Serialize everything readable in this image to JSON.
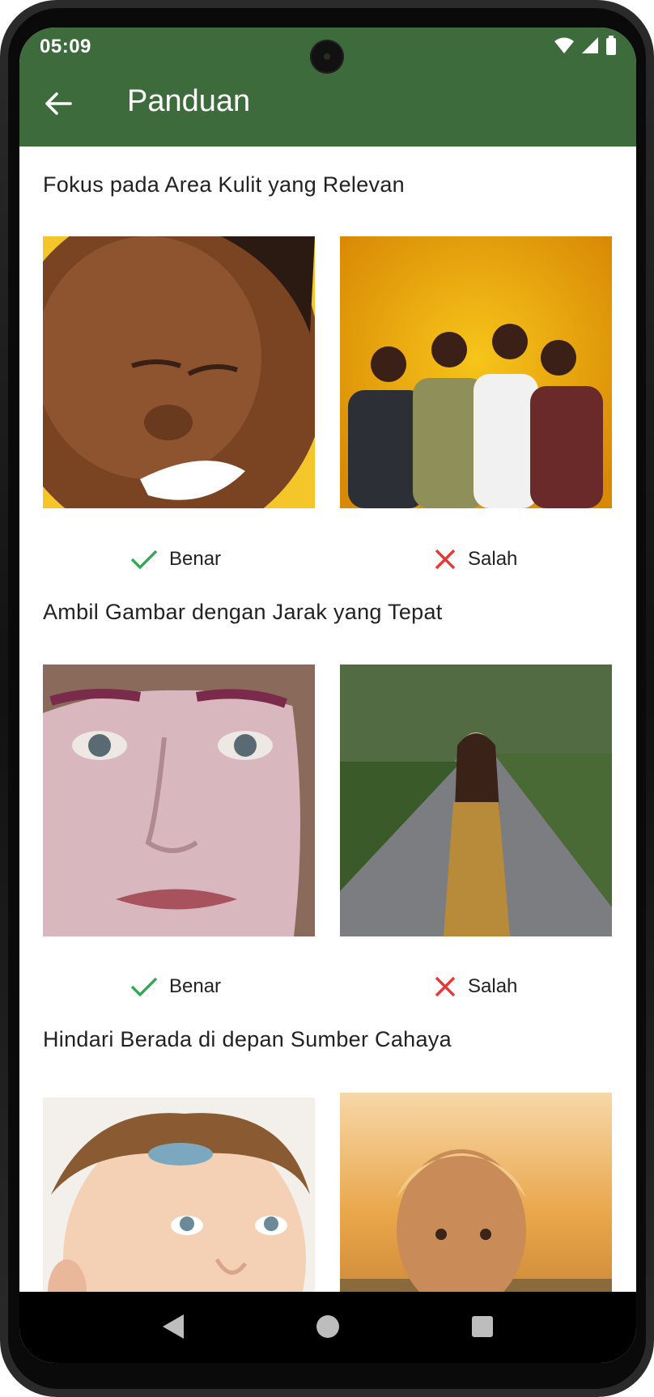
{
  "status_bar": {
    "time": "05:09"
  },
  "app_bar": {
    "title": "Panduan",
    "back_icon": "arrow-left-icon"
  },
  "colors": {
    "app_bar": "#3d6b3c",
    "correct": "#34a853",
    "wrong": "#e53935"
  },
  "sections": [
    {
      "title": "Fokus pada Area Kulit yang Relevan",
      "examples": [
        {
          "label": "Benar",
          "icon": "check-icon"
        },
        {
          "label": "Salah",
          "icon": "cross-icon"
        }
      ]
    },
    {
      "title": "Ambil Gambar dengan Jarak yang Tepat",
      "examples": [
        {
          "label": "Benar",
          "icon": "check-icon"
        },
        {
          "label": "Salah",
          "icon": "cross-icon"
        }
      ]
    },
    {
      "title": "Hindari Berada di depan Sumber Cahaya",
      "examples": []
    }
  ],
  "nav_bar": {
    "buttons": [
      "back-triangle-icon",
      "home-circle-icon",
      "recents-square-icon"
    ]
  }
}
